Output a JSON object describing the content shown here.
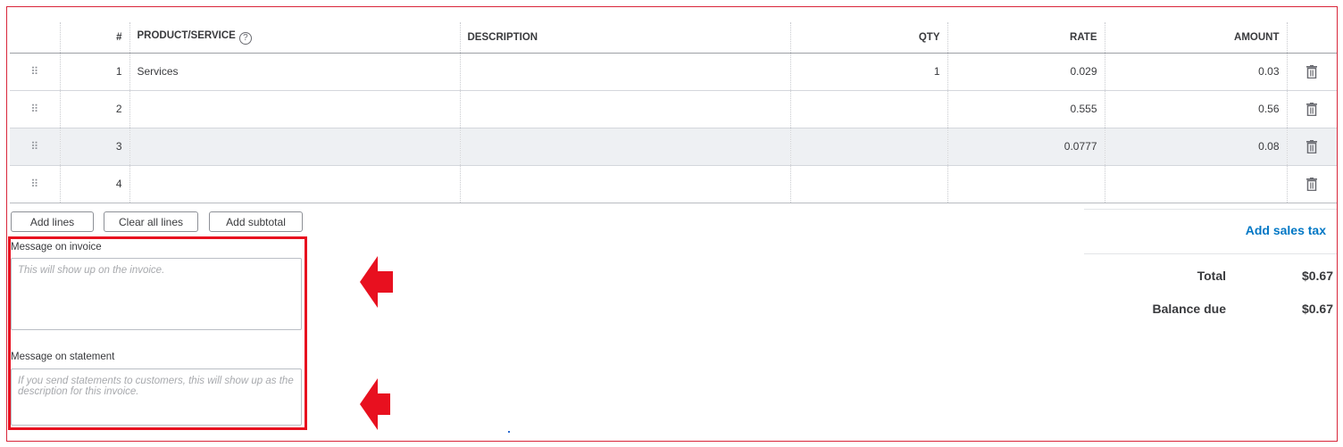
{
  "table": {
    "headers": {
      "num": "#",
      "product": "PRODUCT/SERVICE",
      "description": "DESCRIPTION",
      "qty": "QTY",
      "rate": "RATE",
      "amount": "AMOUNT"
    },
    "rows": [
      {
        "num": "1",
        "product": "Services",
        "description": "",
        "qty": "1",
        "rate": "0.029",
        "amount": "0.03"
      },
      {
        "num": "2",
        "product": "",
        "description": "",
        "qty": "",
        "rate": "0.555",
        "amount": "0.56"
      },
      {
        "num": "3",
        "product": "",
        "description": "",
        "qty": "",
        "rate": "0.0777",
        "amount": "0.08"
      },
      {
        "num": "4",
        "product": "",
        "description": "",
        "qty": "",
        "rate": "",
        "amount": ""
      }
    ]
  },
  "actions": {
    "add_lines": "Add lines",
    "clear_all_lines": "Clear all lines",
    "add_subtotal": "Add subtotal"
  },
  "messages": {
    "invoice_label": "Message on invoice",
    "invoice_placeholder": "This will show up on the invoice.",
    "invoice_value": "",
    "statement_label": "Message on statement",
    "statement_placeholder": "If you send statements to customers, this will show up as the description for this invoice.",
    "statement_value": ""
  },
  "totals": {
    "add_sales_tax": "Add sales tax",
    "total_label": "Total",
    "total_value": "$0.67",
    "balance_label": "Balance due",
    "balance_value": "$0.67"
  },
  "colors": {
    "annotation_red": "#e8101f",
    "link_blue": "#0077c5",
    "highlight_row": "#eef0f3"
  },
  "icons": {
    "drag": "drag-handle-icon",
    "delete": "trash-icon",
    "help": "help-circle-icon",
    "annotation": "red-arrow-icon"
  }
}
